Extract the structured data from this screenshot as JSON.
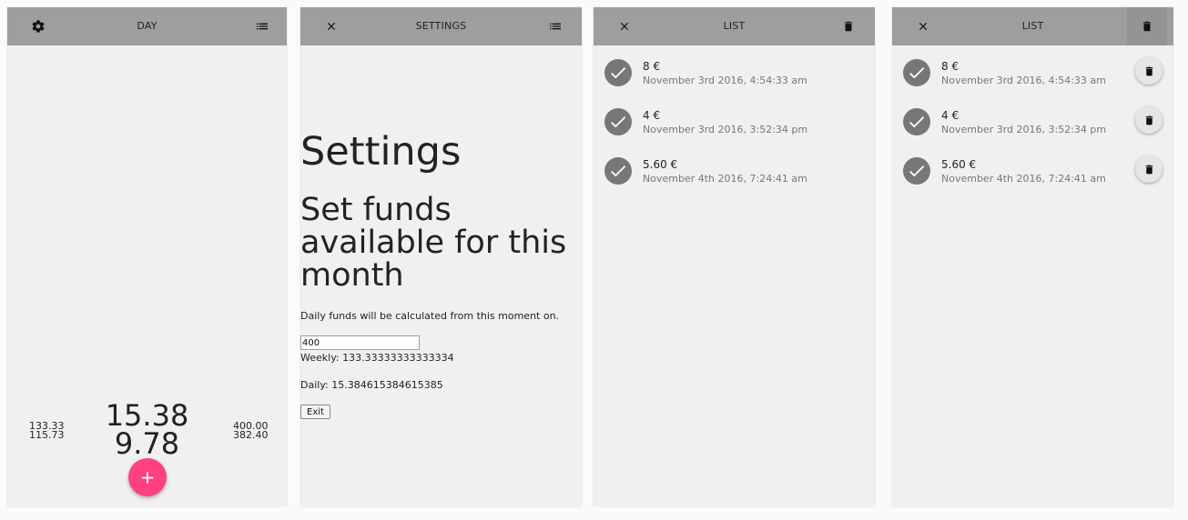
{
  "day": {
    "title": "DAY",
    "left_top": "133.33",
    "left_bottom": "115.73",
    "main_top": "15.38",
    "main_bottom": "9.78",
    "right_top": "400.00",
    "right_bottom": "382.40",
    "fab_label": "+"
  },
  "settings": {
    "title": "SETTINGS",
    "heading": "Settings",
    "subheading": "Set funds available for this month",
    "description": "Daily funds will be calculated from this moment on.",
    "funds_value": "400",
    "weekly": "Weekly: 133.33333333333334",
    "daily": "Daily: 15.384615384615385",
    "exit_label": "Exit"
  },
  "list": {
    "title": "LIST",
    "items": [
      {
        "amount": "8 €",
        "date": "November 3rd 2016, 4:54:33 am"
      },
      {
        "amount": "4 €",
        "date": "November 3rd 2016, 3:52:34 pm"
      },
      {
        "amount": "5.60 €",
        "date": "November 4th 2016, 7:24:41 am"
      }
    ]
  },
  "list_edit": {
    "title": "LIST",
    "items": [
      {
        "amount": "8 €",
        "date": "November 3rd 2016, 4:54:33 am"
      },
      {
        "amount": "4 €",
        "date": "November 3rd 2016, 3:52:34 pm"
      },
      {
        "amount": "5.60 €",
        "date": "November 4th 2016, 7:24:41 am"
      }
    ]
  },
  "colors": {
    "appbar": "#9e9e9e",
    "background": "#f0f0f0",
    "fab": "#ff4081",
    "check": "#777777"
  },
  "icons": {
    "settings": "gear-icon",
    "list": "list-icon",
    "close": "close-icon",
    "delete": "trash-icon",
    "check": "check-icon",
    "add": "plus-icon"
  }
}
